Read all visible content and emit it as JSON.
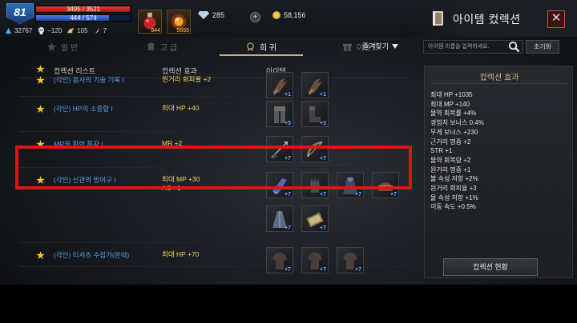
{
  "player": {
    "level": "81",
    "hp_text": "3495 / 3521",
    "hp_ratio": 0.99,
    "mp_text": "444 / 574",
    "mp_ratio": 0.77,
    "stats": {
      "power": "32767",
      "skull": "−120",
      "wing": "105",
      "feather": "7"
    }
  },
  "consumables": [
    {
      "name": "hp-potion",
      "count": "844"
    },
    {
      "name": "elixir",
      "count": "5655"
    }
  ],
  "currency": {
    "diamond": "285",
    "gold": "58,156"
  },
  "header": {
    "title": "아이템 컸렉션",
    "close_label": "✕"
  },
  "tabs": [
    {
      "label": "일 반",
      "active": false
    },
    {
      "label": "고 급",
      "active": false
    },
    {
      "label": "희 귀",
      "active": true
    },
    {
      "label": "이벤트",
      "active": false
    }
  ],
  "filter": {
    "favorites_label": "즐겨찾기",
    "search_placeholder": "아이템 이름을 입력하세요.",
    "reset_label": "초기화"
  },
  "list": {
    "headers": {
      "name": "컸렉션 리스트",
      "effect": "컸렉션 효과",
      "items": "아이템"
    },
    "rows": [
      {
        "name": "(각인) 용사의 기술 기록 I",
        "effect": "원거리 회피율 +2",
        "items": [
          {
            "icon": "claw-weapon-icon",
            "plus": "+1"
          },
          {
            "icon": "claw-weapon-icon",
            "plus": "+1"
          }
        ]
      },
      {
        "name": "(각인) HP의 소중함 I",
        "effect": "최대 HP +40",
        "items": [
          {
            "icon": "leg-armor-icon",
            "plus": "+5"
          },
          {
            "icon": "boots-icon",
            "plus": "+3"
          }
        ]
      },
      {
        "name": "MR을 위한 투자 I",
        "effect": "MR +2",
        "items": [
          {
            "icon": "spear-icon",
            "plus": "+7"
          },
          {
            "icon": "bow-icon",
            "plus": "+7"
          }
        ]
      },
      {
        "name": "(각인) 신관의 방어구 I",
        "effect": "최대 MP +30\nAC −1",
        "items": [
          {
            "icon": "gauntlet-icon",
            "plus": "+7"
          },
          {
            "icon": "glove-icon",
            "plus": "+7"
          },
          {
            "icon": "cloak-icon",
            "plus": "+7"
          },
          {
            "icon": "helmet-icon",
            "plus": "+7"
          },
          {
            "icon": "robe-icon",
            "plus": "+7"
          },
          {
            "icon": "book-icon",
            "plus": "+7"
          }
        ]
      },
      {
        "name": "(각인) 티셔츠 수집가(완력)",
        "effect": "최대 HP +70",
        "items": [
          {
            "icon": "shirt-icon",
            "plus": "+7"
          },
          {
            "icon": "shirt-icon",
            "plus": "+7"
          },
          {
            "icon": "shirt-icon",
            "plus": "+7"
          }
        ]
      }
    ]
  },
  "effects": {
    "title": "컸렉션 효과",
    "items": [
      "최대 HP +1035",
      "최대 MP +140",
      "물약 회복률 +4%",
      "경험치 보너스 0.4%",
      "무게 보너스 +230",
      "근거리 명중 +2",
      "STR +1",
      "물약 회복량 +2",
      "원거리 명중 +1",
      "불 속성 저항 +2%",
      "원거리 회피율 +3",
      "물 속성 저항 +1%",
      "이동 속도 +0.5%"
    ],
    "status_button_label": "컸렉션 현황"
  },
  "colors": {
    "collection_name": "#5a9fe6",
    "effect_text": "#f0d45a",
    "highlight": "#e01414",
    "enchant_plus": "#6aa8ff"
  }
}
